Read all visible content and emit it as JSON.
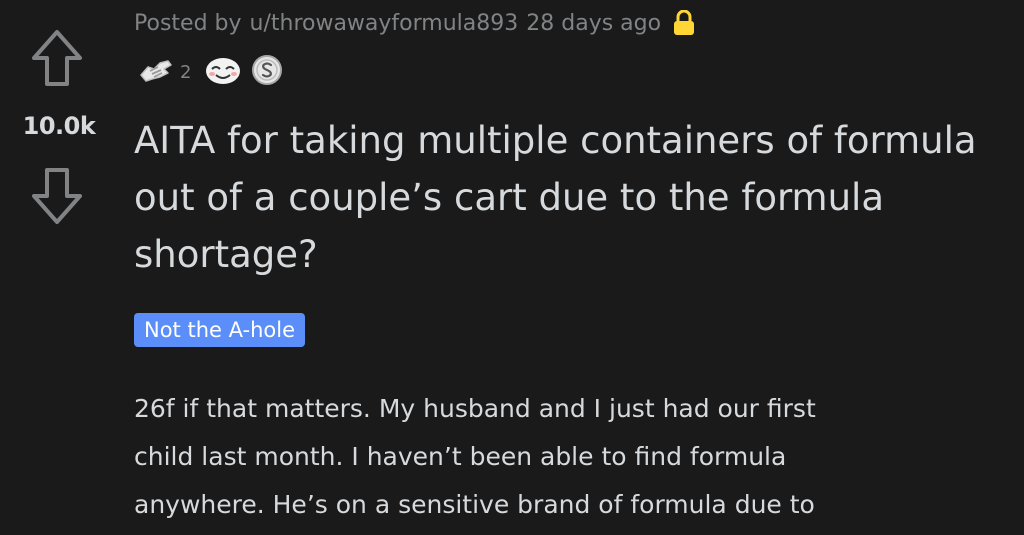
{
  "vote": {
    "score": "10.0k"
  },
  "post": {
    "posted_by_prefix": "Posted by",
    "username": "u/throwawayformula893",
    "age": "28 days ago",
    "awards": [
      {
        "icon": "helping-hands-award-icon",
        "count": "2"
      },
      {
        "icon": "wholesome-face-award-icon",
        "count": ""
      },
      {
        "icon": "silver-coin-award-icon",
        "count": ""
      }
    ],
    "title": "AITA for taking multiple containers of formula out of a couple’s cart due to the formula shortage?",
    "flair": "Not the A-hole",
    "body_lines": [
      "26f if that matters. My husband and I just had our first",
      "child last month. I haven’t been able to find formula",
      "anywhere. He’s on a sensitive brand of formula due to"
    ]
  },
  "colors": {
    "background": "#1a1a1b",
    "text": "#d7dadc",
    "meta": "#818384",
    "flair_bg": "#5b8ef8",
    "lock": "#ffd635"
  }
}
